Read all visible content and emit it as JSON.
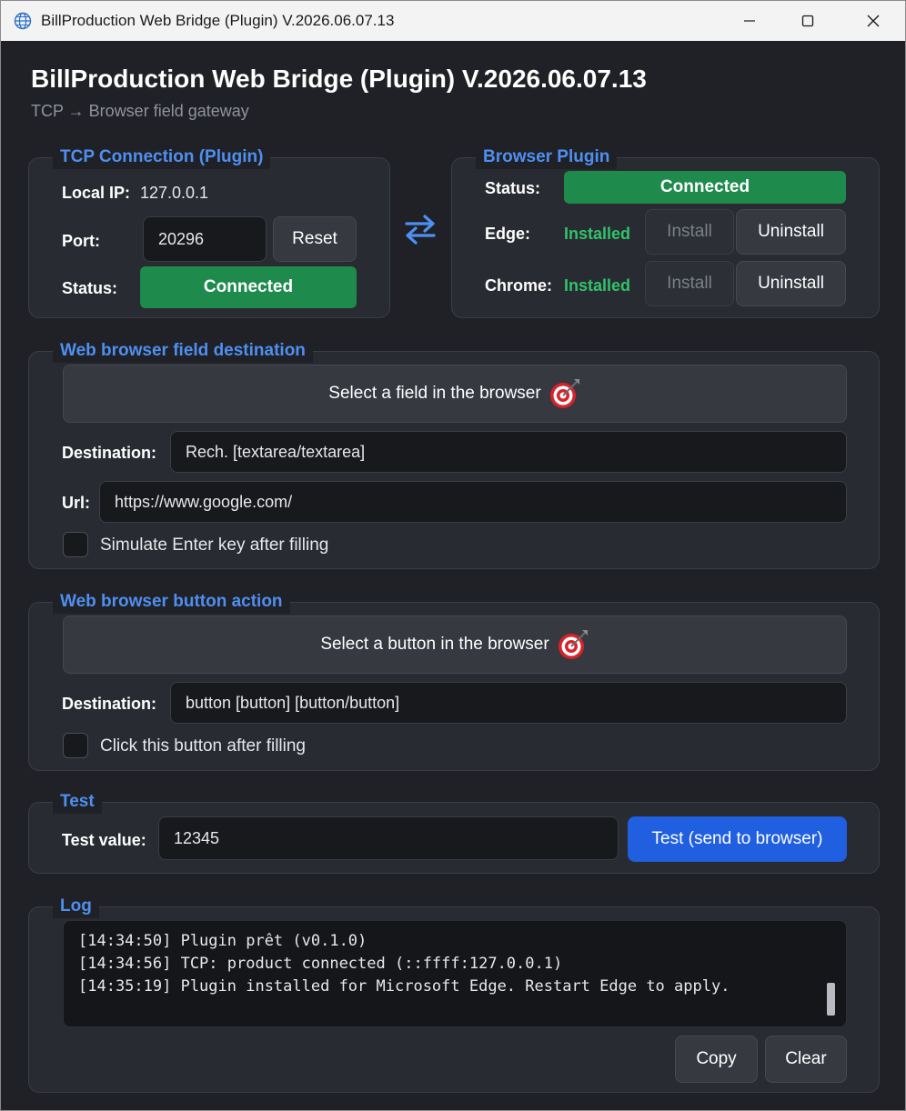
{
  "window": {
    "title": "BillProduction Web Bridge (Plugin) V.2026.06.07.13"
  },
  "header": {
    "title": "BillProduction Web Bridge (Plugin) V.2026.06.07.13",
    "subtitle": "TCP → Browser field gateway"
  },
  "tcp": {
    "legend": "TCP Connection (Plugin)",
    "local_ip_label": "Local IP:",
    "local_ip": "127.0.0.1",
    "port_label": "Port:",
    "port_value": "20296",
    "reset_label": "Reset",
    "status_label": "Status:",
    "status_value": "Connected"
  },
  "plugin": {
    "legend": "Browser Plugin",
    "status_label": "Status:",
    "status_value": "Connected",
    "edge_label": "Edge:",
    "edge_state": "Installed",
    "chrome_label": "Chrome:",
    "chrome_state": "Installed",
    "install_label": "Install",
    "uninstall_label": "Uninstall"
  },
  "field_dest": {
    "legend": "Web browser field destination",
    "select_label": "Select a field in the browser",
    "destination_label": "Destination:",
    "destination_value": "Rech.  [textarea/textarea]",
    "url_label": "Url:",
    "url_value": "https://www.google.com/",
    "enter_checkbox_label": "Simulate Enter key after filling",
    "enter_checked": false
  },
  "button_action": {
    "legend": "Web browser button action",
    "select_label": "Select a button in the browser",
    "destination_label": "Destination:",
    "destination_value": "button [button]  [button/button]",
    "click_checkbox_label": "Click this button after filling",
    "click_checked": false
  },
  "test": {
    "legend": "Test",
    "value_label": "Test value:",
    "value": "12345",
    "send_label": "Test (send to browser)"
  },
  "log": {
    "legend": "Log",
    "lines": [
      "[14:34:50] Plugin prêt (v0.1.0)",
      "[14:34:56] TCP: product connected (::ffff:127.0.0.1)",
      "[14:35:19] Plugin installed for Microsoft Edge. Restart Edge to apply."
    ],
    "copy_label": "Copy",
    "clear_label": "Clear"
  },
  "colors": {
    "accent": "#4f8ff0",
    "success": "#1e8a4c",
    "installed": "#32c26a",
    "primary_button": "#1f5fe0"
  },
  "icons": [
    "globe-icon",
    "minimize-icon",
    "maximize-icon",
    "close-icon",
    "swap-arrows-icon",
    "target-icon"
  ]
}
